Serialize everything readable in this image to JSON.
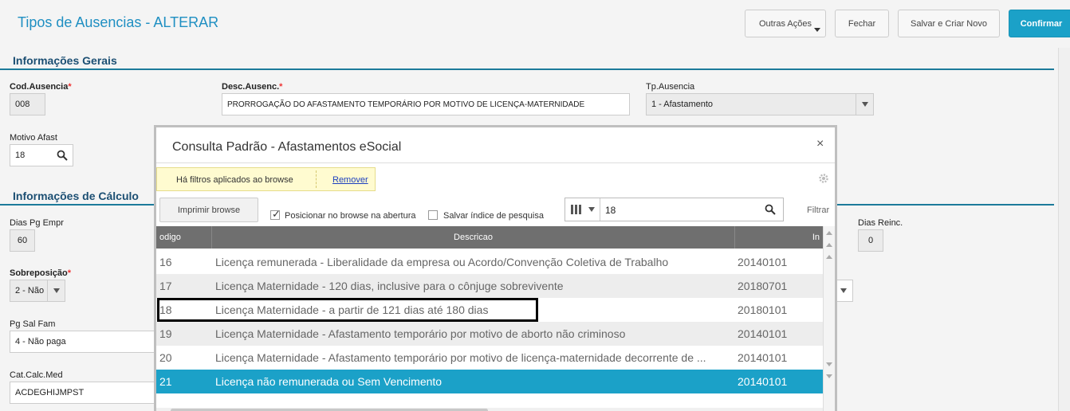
{
  "header": {
    "title": "Tipos de Ausencias - ALTERAR",
    "buttons": {
      "outras": "Outras Ações",
      "fechar": "Fechar",
      "salvar_novo": "Salvar e Criar Novo",
      "confirmar": "Confirmar"
    }
  },
  "sections": {
    "gerais": "Informações Gerais",
    "calculo": "Informações de Cálculo"
  },
  "form": {
    "cod_label": "Cod.Ausencia",
    "cod_value": "008",
    "desc_label": "Desc.Ausenc.",
    "desc_value": "PRORROGAÇÃO DO AFASTAMENTO TEMPORÁRIO POR MOTIVO DE LICENÇA-MATERNIDADE",
    "tp_label": "Tp.Ausencia",
    "tp_value": "1 - Afastamento",
    "motivo_label": "Motivo Afast",
    "motivo_value": "18",
    "dias_pg_label": "Dias Pg Empr",
    "dias_pg_value": "60",
    "dias_reinc_label": "Dias Reinc.",
    "dias_reinc_value": "0",
    "sobre_label": "Sobreposição",
    "sobre_value": "2 - Não",
    "pgsal_label": "Pg Sal Fam",
    "pgsal_value": "4 - Não paga",
    "catcalc_label": "Cat.Calc.Med",
    "catcalc_value": "ACDEGHIJMPST",
    "required_mark": "*"
  },
  "modal": {
    "title": "Consulta Padrão - Afastamentos eSocial",
    "close": "×",
    "notice_text": "Há filtros aplicados ao browse",
    "notice_link": "Remover",
    "print_button": "Imprimir browse",
    "check1_label": "Posicionar no browse na abertura",
    "check1_mark": "✓",
    "check2_label": "Salvar índice de pesquisa",
    "search_value": "18",
    "filtrar": "Filtrar",
    "columns": [
      "odigo",
      "Descricao",
      "In"
    ],
    "rows": [
      {
        "code": "16",
        "desc": "Licença remunerada - Liberalidade da empresa ou Acordo/Convenção Coletiva de Trabalho",
        "date": "20140101"
      },
      {
        "code": "17",
        "desc": "Licença Maternidade - 120 dias, inclusive para o cônjuge sobrevivente",
        "date": "20180701"
      },
      {
        "code": "18",
        "desc": "Licença Maternidade - a partir de 121 dias até 180 dias",
        "date": "20180101"
      },
      {
        "code": "19",
        "desc": "Licença Maternidade - Afastamento temporário por motivo de aborto não criminoso",
        "date": "20140101"
      },
      {
        "code": "20",
        "desc": "Licença Maternidade - Afastamento temporário por motivo de licença-maternidade decorrente de ...",
        "date": "20140101"
      },
      {
        "code": "21",
        "desc": "Licença não remunerada ou Sem Vencimento",
        "date": "20140101"
      }
    ]
  }
}
